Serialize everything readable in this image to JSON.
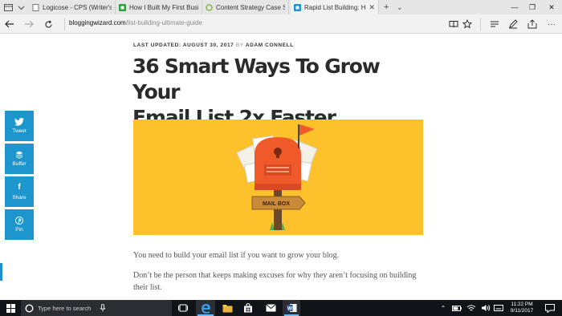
{
  "browser": {
    "tabs": [
      {
        "title": "Logicose - CPS (Writer's Par",
        "active": false,
        "favicon": "generic-page-icon"
      },
      {
        "title": "How I Built My First Busines",
        "active": false,
        "favicon": "green-square-icon"
      },
      {
        "title": "Content Strategy Case Stud",
        "active": false,
        "favicon": "green-circle-icon"
      },
      {
        "title": "Rapid List Building: How",
        "active": true,
        "favicon": "blue-square-icon"
      }
    ],
    "url": {
      "host": "bloggingwizard.com",
      "path": "/list-building-ultimate-guide"
    }
  },
  "article": {
    "meta": {
      "updated": "LAST UPDATED: AUGUST 30, 2017",
      "by": "BY",
      "author": "ADAM CONNELL"
    },
    "title_line1": "36 Smart Ways To Grow Your",
    "title_line2": "Email List 2x Faster",
    "hero": {
      "sign_text": "MAIL BOX",
      "colors": {
        "background": "#fdc12b",
        "mailbox": "#f0592a",
        "post": "#6b4a2b",
        "sign": "#c98b3a",
        "flag": "#f0592a"
      }
    },
    "paragraphs": [
      "You need to build your email list if you want to grow your blog.",
      "Don’t be the person that keeps making excuses for why they aren’t focusing on building",
      "their list."
    ]
  },
  "share": [
    {
      "label": "Tweet",
      "icon": "twitter-bird-icon"
    },
    {
      "label": "Buffer",
      "icon": "buffer-stack-icon"
    },
    {
      "label": "Share",
      "icon": "facebook-f-icon"
    },
    {
      "label": "Pin",
      "icon": "pinterest-p-icon"
    }
  ],
  "taskbar": {
    "search_placeholder": "Type here to search",
    "time": "11:22 PM",
    "date": "9/11/2017"
  },
  "colors": {
    "accent": "#1c96cc",
    "tabbar": "#e6e6e6",
    "taskbar": "#101418"
  }
}
